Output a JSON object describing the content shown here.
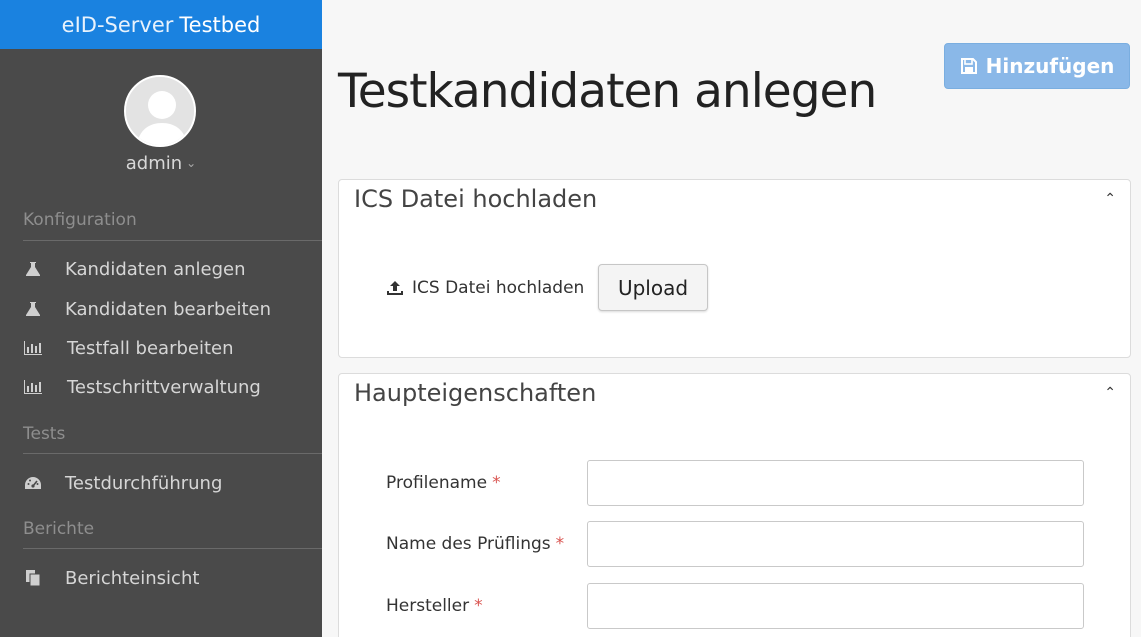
{
  "sidebar": {
    "brand_prefix": "eID-Server",
    "brand_suffix": "Testbed",
    "user": {
      "name": "admin",
      "avatar_icon": "user-avatar-icon"
    },
    "sections": [
      {
        "heading": "Konfiguration",
        "items": [
          {
            "label": "Kandidaten anlegen",
            "icon": "flask-icon"
          },
          {
            "label": "Kandidaten bearbeiten",
            "icon": "flask-icon"
          },
          {
            "label": "Testfall bearbeiten",
            "icon": "bar-chart-icon"
          },
          {
            "label": "Testschrittverwaltung",
            "icon": "bar-chart-icon"
          }
        ]
      },
      {
        "heading": "Tests",
        "items": [
          {
            "label": "Testdurchführung",
            "icon": "dashboard-icon"
          }
        ]
      },
      {
        "heading": "Berichte",
        "items": [
          {
            "label": "Berichteinsicht",
            "icon": "copy-icon"
          }
        ]
      }
    ]
  },
  "main": {
    "title": "Testkandidaten anlegen",
    "add_button_label": "Hinzufügen",
    "panels": {
      "ics": {
        "title": "ICS Datei hochladen",
        "upload_label": "ICS Datei hochladen",
        "upload_button": "Upload"
      },
      "properties": {
        "title": "Haupteigenschaften",
        "fields": [
          {
            "label": "Profilename",
            "required_mark": "*",
            "value": ""
          },
          {
            "label": "Name des Prüflings",
            "required_mark": "*",
            "value": ""
          },
          {
            "label": "Hersteller",
            "required_mark": "*",
            "value": ""
          }
        ]
      }
    }
  },
  "colors": {
    "brand": "#1a82e0",
    "sidebar_bg": "#4a4a4a",
    "primary_button": "#8ab8e8",
    "required": "#d9534f"
  }
}
